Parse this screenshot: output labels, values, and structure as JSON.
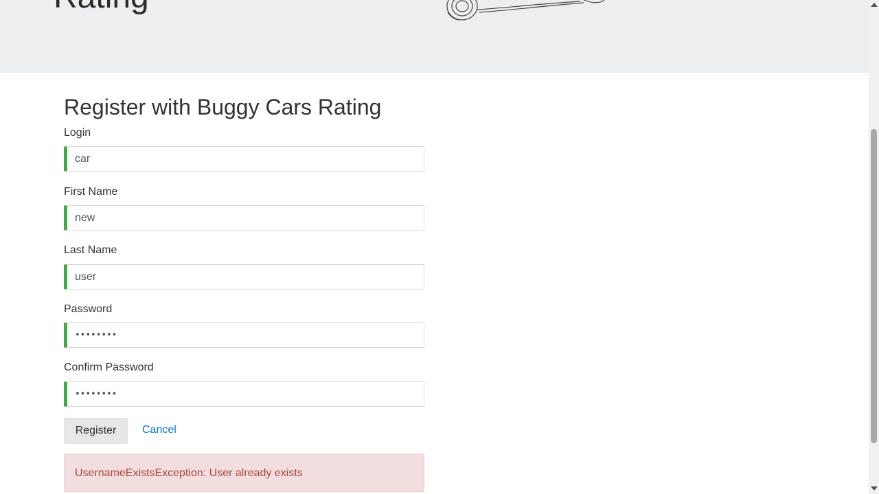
{
  "header": {
    "brand_title": "Rating"
  },
  "form": {
    "title": "Register with Buggy Cars Rating",
    "fields": [
      {
        "label": "Login",
        "value": "car"
      },
      {
        "label": "First Name",
        "value": "new"
      },
      {
        "label": "Last Name",
        "value": "user"
      },
      {
        "label": "Password",
        "value": "••••••••"
      },
      {
        "label": "Confirm Password",
        "value": "••••••••"
      }
    ],
    "register_label": "Register",
    "cancel_label": "Cancel",
    "error_message": "UsernameExistsException: User already exists"
  },
  "colors": {
    "valid_border": "#42a948",
    "link": "#0275d8",
    "error_bg": "#f2dede",
    "error_text": "#a94442",
    "header_bg": "#eceeef"
  },
  "icons": {
    "car_illustration": "car-sketch-icon"
  }
}
